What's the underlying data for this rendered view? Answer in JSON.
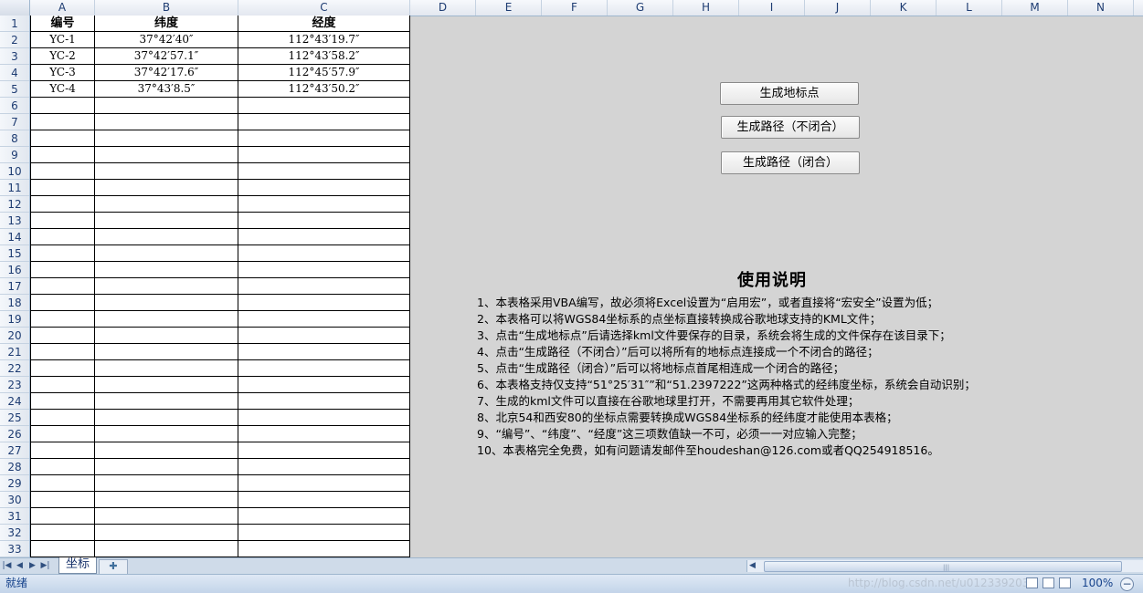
{
  "columns": [
    "A",
    "B",
    "C",
    "D",
    "E",
    "F",
    "G",
    "H",
    "I",
    "J",
    "K",
    "L",
    "M",
    "N"
  ],
  "rows": [
    "1",
    "2",
    "3",
    "4",
    "5",
    "6",
    "7",
    "8",
    "9",
    "10",
    "11",
    "12",
    "13",
    "14",
    "15",
    "16",
    "17",
    "18",
    "19",
    "20",
    "21",
    "22",
    "23",
    "24",
    "25",
    "26",
    "27",
    "28",
    "29",
    "30",
    "31",
    "32",
    "33"
  ],
  "table": {
    "headers": [
      "编号",
      "纬度",
      "经度"
    ],
    "data": [
      [
        "YC-1",
        "37°42′40″",
        "112°43′19.7″"
      ],
      [
        "YC-2",
        "37°42′57.1″",
        "112°43′58.2″"
      ],
      [
        "YC-3",
        "37°42′17.6″",
        "112°45′57.9″"
      ],
      [
        "YC-4",
        "37°43′8.5″",
        "112°43′50.2″"
      ]
    ]
  },
  "buttons": {
    "generate_points": "生成地标点",
    "generate_path_open": "生成路径（不闭合）",
    "generate_path_closed": "生成路径（闭合）"
  },
  "instructions": {
    "title": "使用说明",
    "items": [
      "1、本表格采用VBA编写，故必须将Excel设置为“启用宏”，或者直接将“宏安全”设置为低；",
      "2、本表格可以将WGS84坐标系的点坐标直接转换成谷歌地球支持的KML文件；",
      "3、点击“生成地标点”后请选择kml文件要保存的目录，系统会将生成的文件保存在该目录下；",
      "4、点击“生成路径（不闭合）”后可以将所有的地标点连接成一个不闭合的路径；",
      "5、点击“生成路径（闭合）”后可以将地标点首尾相连成一个闭合的路径；",
      "6、本表格支持仅支持“51°25′31″”和“51.2397222”这两种格式的经纬度坐标，系统会自动识别；",
      "7、生成的kml文件可以直接在谷歌地球里打开，不需要再用其它软件处理；",
      "8、北京54和西安80的坐标点需要转换成WGS84坐标系的经纬度才能使用本表格；",
      "9、“编号”、“纬度”、“经度”这三项数值缺一不可，必须一一对应输入完整；",
      "10、本表格完全免费，如有问题请发邮件至houdeshan@126.com或者QQ254918516。"
    ]
  },
  "sheet_tabs": {
    "active": "坐标"
  },
  "status_bar": {
    "status": "就绪",
    "watermark": "http://blog.csdn.net/u012339203",
    "zoom": "100%"
  }
}
